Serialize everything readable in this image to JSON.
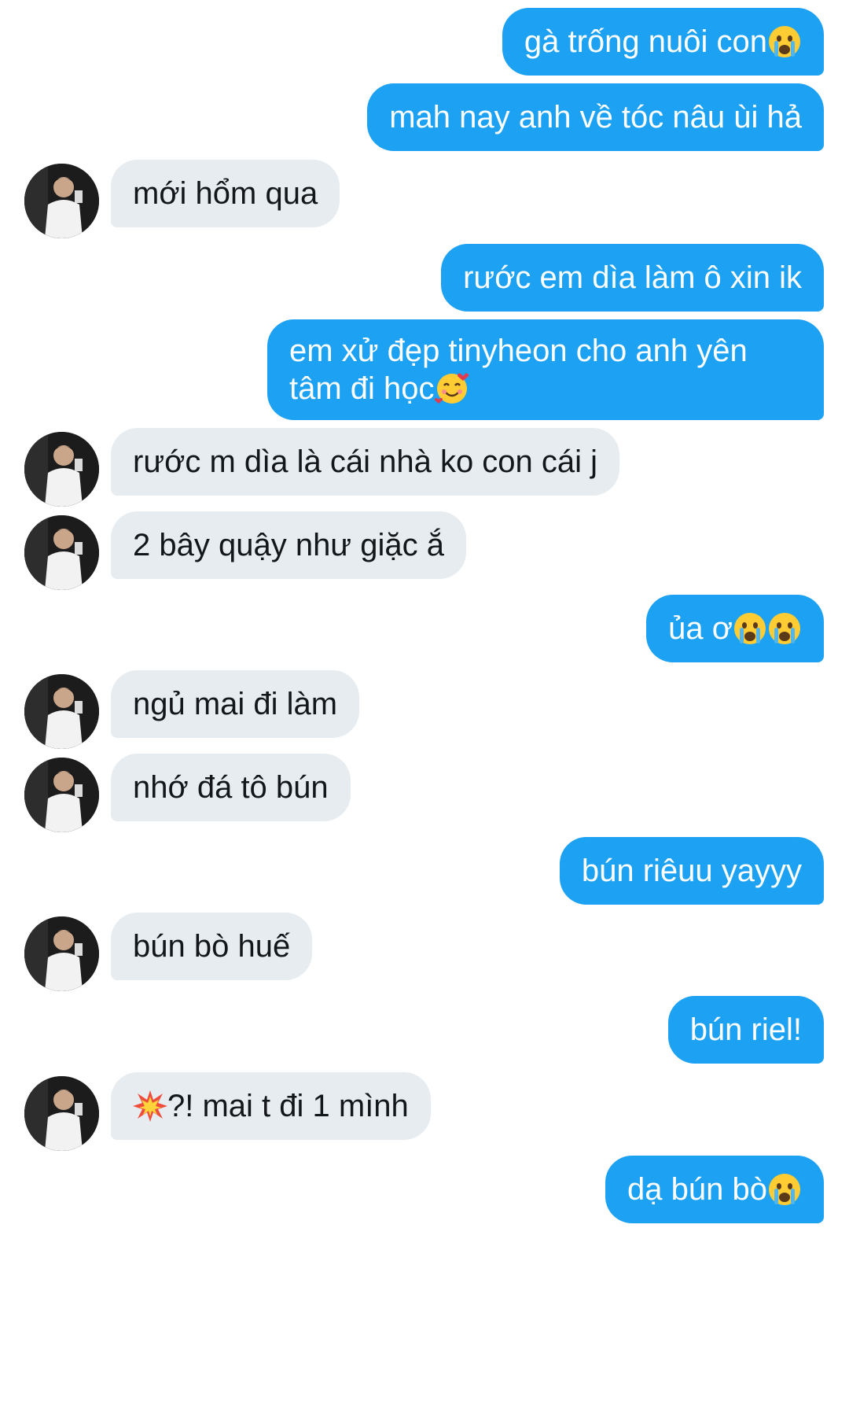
{
  "messages": [
    {
      "side": "out",
      "text": "gà trống nuôi con",
      "emoji": [
        "crying-face"
      ]
    },
    {
      "side": "out",
      "text": "mah nay anh về tóc nâu ùi hả",
      "emoji": []
    },
    {
      "side": "in",
      "text": "mới hổm qua",
      "emoji": []
    },
    {
      "side": "out",
      "text": "rước em dìa làm ô xin ik",
      "emoji": []
    },
    {
      "side": "out",
      "line1": "em xử đẹp tinyheon cho anh yên",
      "line2": "tâm đi học",
      "emoji": [
        "smiling-face-with-hearts"
      ]
    },
    {
      "side": "in",
      "text": "rước m dìa là cái nhà ko con cái j",
      "emoji": []
    },
    {
      "side": "in",
      "text": "2 bây quậy như giặc ắ",
      "emoji": []
    },
    {
      "side": "out",
      "text": "ủa ơ",
      "emoji": [
        "crying-face",
        "crying-face"
      ]
    },
    {
      "side": "in",
      "text": "ngủ mai đi làm",
      "emoji": []
    },
    {
      "side": "in",
      "text": "nhớ đá tô bún",
      "emoji": []
    },
    {
      "side": "out",
      "text": "bún riêuu yayyy",
      "emoji": []
    },
    {
      "side": "in",
      "text": "bún bò huế",
      "emoji": []
    },
    {
      "side": "out",
      "text": "bún riel!",
      "emoji": []
    },
    {
      "side": "in",
      "text": "?! mai t đi 1 mình",
      "emoji_before": [
        "collision"
      ]
    },
    {
      "side": "out",
      "text": "dạ bún bò",
      "emoji": [
        "crying-face"
      ]
    }
  ],
  "colors": {
    "outgoing_bubble": "#1da1f2",
    "outgoing_text": "#ffffff",
    "incoming_bubble": "#e6ecf0",
    "incoming_text": "#14171a",
    "background": "#ffffff"
  },
  "avatar": {
    "icon": "user-avatar-photo"
  }
}
